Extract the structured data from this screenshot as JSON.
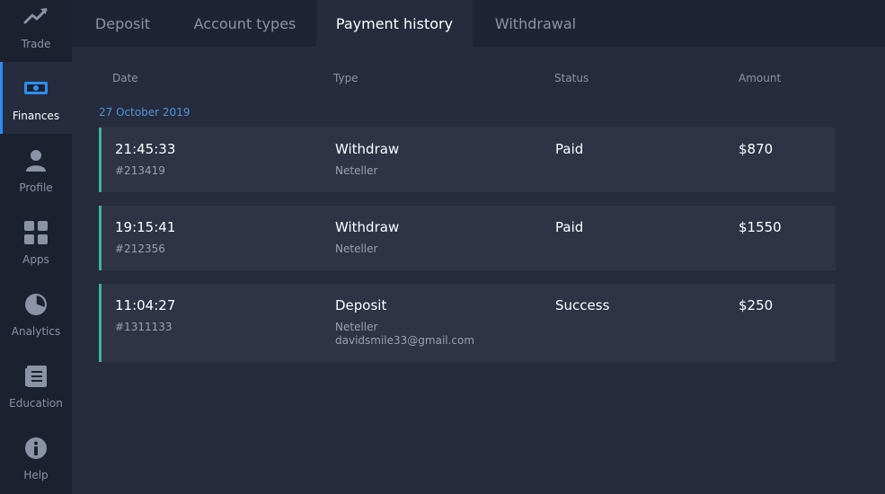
{
  "sidebar": {
    "items": [
      {
        "label": "Trade",
        "icon": "trend-up-icon"
      },
      {
        "label": "Finances",
        "icon": "banknote-icon",
        "active": true
      },
      {
        "label": "Profile",
        "icon": "user-icon"
      },
      {
        "label": "Apps",
        "icon": "grid-icon"
      },
      {
        "label": "Analytics",
        "icon": "pie-chart-icon"
      },
      {
        "label": "Education",
        "icon": "document-icon"
      },
      {
        "label": "Help",
        "icon": "info-icon"
      }
    ]
  },
  "tabs": [
    {
      "label": "Deposit"
    },
    {
      "label": "Account types"
    },
    {
      "label": "Payment history",
      "active": true
    },
    {
      "label": "Withdrawal"
    }
  ],
  "table": {
    "columns": [
      "Date",
      "Type",
      "Status",
      "Amount"
    ],
    "date_group": "27 October 2019",
    "rows": [
      {
        "time": "21:45:33",
        "id": "#213419",
        "type": "Withdraw",
        "method": "Neteller",
        "email": "",
        "status": "Paid",
        "amount": "$870"
      },
      {
        "time": "19:15:41",
        "id": "#212356",
        "type": "Withdraw",
        "method": "Neteller",
        "email": "",
        "status": "Paid",
        "amount": "$1550"
      },
      {
        "time": "11:04:27",
        "id": "#1311133",
        "type": "Deposit",
        "method": "Neteller",
        "email": "davidsmile33@gmail.com",
        "status": "Success",
        "amount": "$250"
      }
    ]
  },
  "colors": {
    "accent_blue": "#2f8ef2",
    "row_border": "#3bb59a",
    "date_group": "#4f95d9"
  }
}
